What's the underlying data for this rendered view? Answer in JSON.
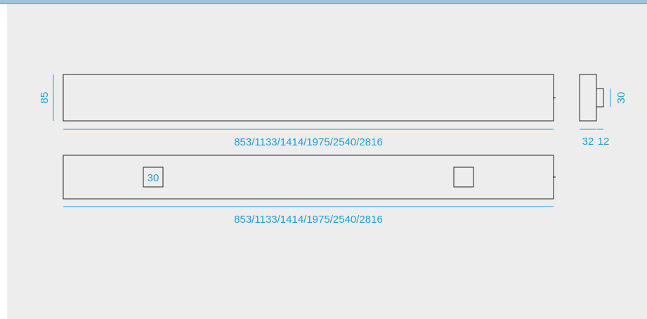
{
  "colors": {
    "dimension": "#1e9ed8",
    "outline": "#222222",
    "panel_background": "#ededed",
    "top_border": "#9ec3dc"
  },
  "front_view": {
    "height_label": "85",
    "length_label": "853/1133/1414/1975/2540/2816"
  },
  "side_view": {
    "bracket_height_label": "30",
    "depth_label": "32",
    "bracket_depth_label": "12"
  },
  "rear_view": {
    "bracket_size_label": "30",
    "length_label": "853/1133/1414/1975/2540/2816"
  }
}
